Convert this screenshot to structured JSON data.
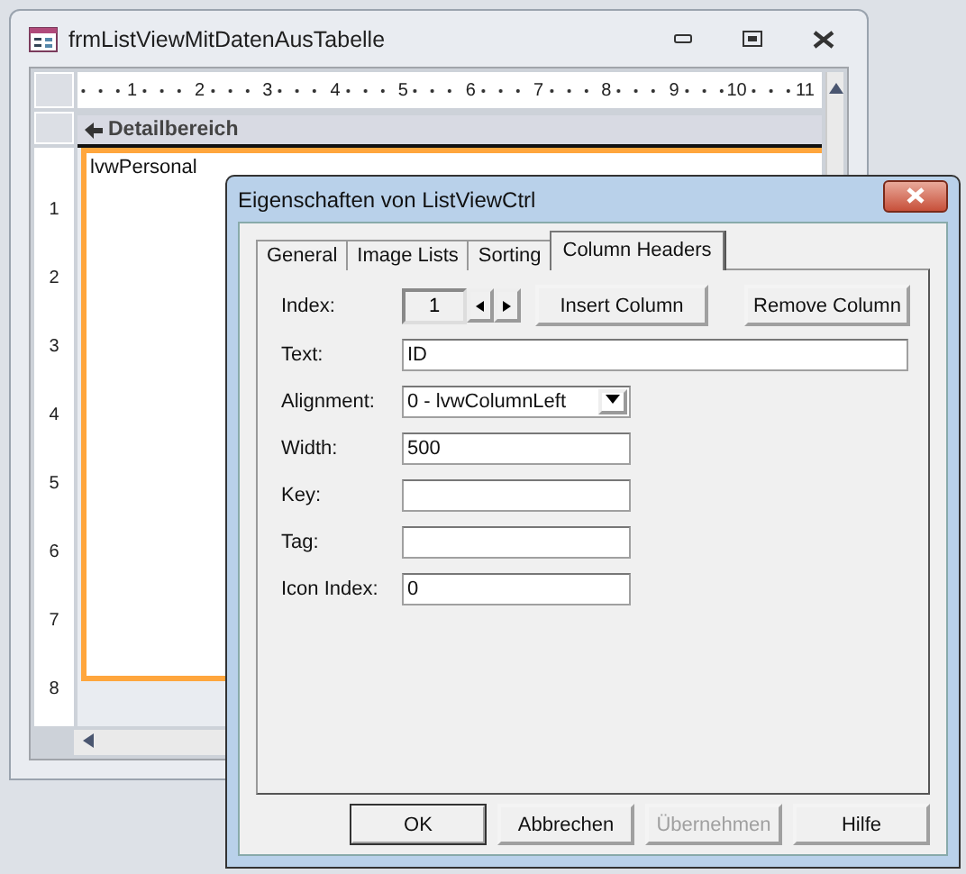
{
  "form_window": {
    "title": "frmListViewMitDatenAusTabelle"
  },
  "ruler_horizontal": [
    "1",
    "2",
    "3",
    "4",
    "5",
    "6",
    "7",
    "8",
    "9",
    "10",
    "11"
  ],
  "ruler_vertical": [
    "1",
    "2",
    "3",
    "4",
    "5",
    "6",
    "7",
    "8"
  ],
  "section": {
    "title": "Detailbereich"
  },
  "control": {
    "name": "lvwPersonal"
  },
  "dialog": {
    "title": "Eigenschaften von ListViewCtrl",
    "tabs": [
      {
        "label": "General",
        "selected": false
      },
      {
        "label": "Image Lists",
        "selected": false
      },
      {
        "label": "Sorting",
        "selected": false
      },
      {
        "label": "Column Headers",
        "selected": true
      }
    ],
    "index": {
      "label": "Index:",
      "value": "1"
    },
    "insert_button": "Insert Column",
    "remove_button": "Remove Column",
    "fields": [
      {
        "kind": "text",
        "label": "Text:",
        "value": "ID",
        "wide": true
      },
      {
        "kind": "select",
        "label": "Alignment:",
        "value": "0 - lvwColumnLeft"
      },
      {
        "kind": "text",
        "label": "Width:",
        "value": "500"
      },
      {
        "kind": "text",
        "label": "Key:"
      },
      {
        "kind": "text",
        "label": "Tag:"
      },
      {
        "kind": "text",
        "label": "Icon Index:",
        "value": "0"
      }
    ],
    "buttons": [
      {
        "label": "OK",
        "disabled": false,
        "default": true
      },
      {
        "label": "Abbrechen",
        "disabled": false,
        "default": false
      },
      {
        "label": "Übernehmen",
        "disabled": true,
        "default": false
      },
      {
        "label": "Hilfe",
        "disabled": false,
        "default": false
      }
    ]
  }
}
